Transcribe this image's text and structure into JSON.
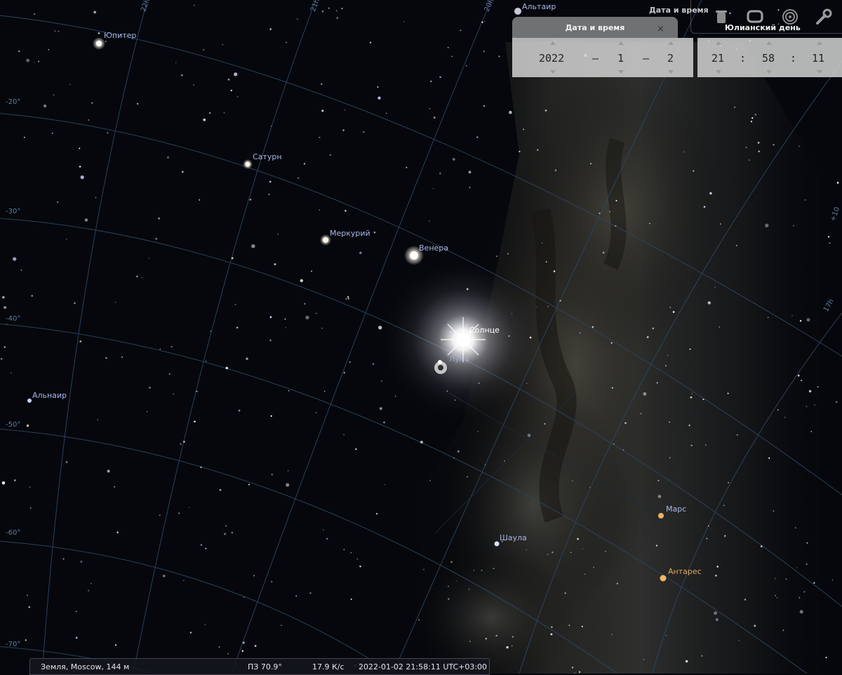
{
  "objects": {
    "jupiter": "Юпитер",
    "saturn": "Сатурн",
    "mercury": "Меркурий",
    "venus": "Венера",
    "sun": "Солнце",
    "moon": "Луна",
    "altair": "Альтаир",
    "alnair": "Альнаир",
    "shaula": "Шаула",
    "mars": "Марс",
    "antares": "Антарес"
  },
  "grid_labels": {
    "dec_m20": "-20°",
    "dec_m30": "-30°",
    "dec_m40": "-40°",
    "dec_m50": "-50°",
    "dec_m60": "-60°",
    "dec_m70": "-70°",
    "ra_22h": "22h",
    "ra_21h": "21h",
    "ra_20h": "20h",
    "ra_17h": "17h",
    "dec_p10": "+10"
  },
  "datetime_panel": {
    "title": "Дата и время",
    "close": "×",
    "year": "2022",
    "sep1": "–",
    "month": "1",
    "sep2": "–",
    "day": "2",
    "hour": "21",
    "sep3": ":",
    "minute": "58",
    "sep4": ":",
    "second": "11"
  },
  "toolbar": {
    "title": "Дата и время",
    "subtitle": "Юлианский день",
    "icons": [
      "trash-icon",
      "monitor-icon",
      "target-icon",
      "wrench-icon"
    ]
  },
  "statusbar": {
    "location": "Земля, Moscow, 144 м",
    "fov": "ПЗ 70.9°",
    "fps": "17.9 К/с",
    "datetime": "2022-01-02 21:58:11 UTC+03:00"
  },
  "colors": {
    "sky": "#05070c",
    "grid": "#2d4763",
    "label": "#a9b7e8",
    "antares": "#e0a860",
    "mars": "#f0b060"
  }
}
